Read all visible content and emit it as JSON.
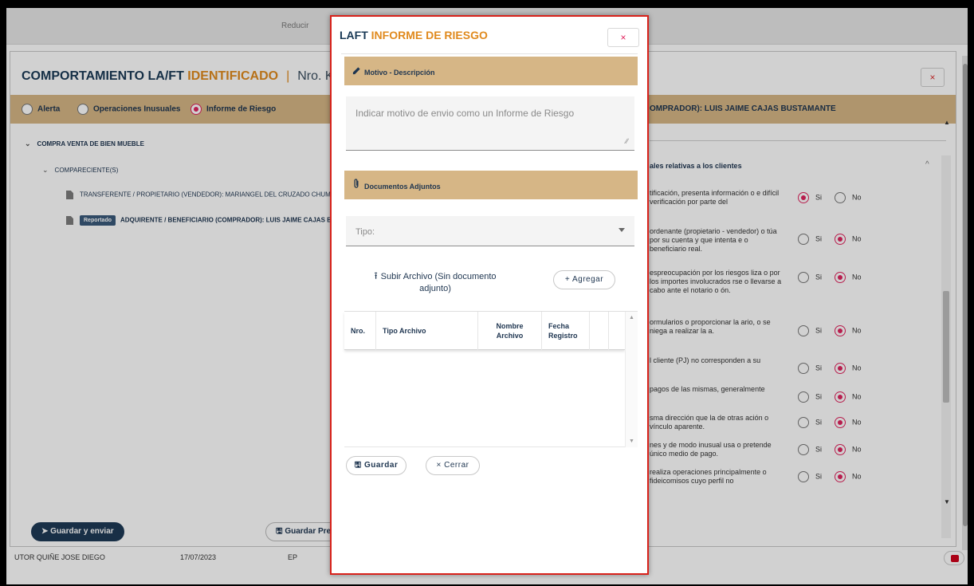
{
  "background": {
    "topbar_label": "Reducir",
    "title_part1": "COMPORTAMIENTO LA/FT",
    "title_part2": "IDENTIFICADO",
    "title_sep": "|",
    "kardex": "Nro. Kardex : AC",
    "close_label": "×",
    "report_types": [
      {
        "label": "Alerta",
        "selected": false
      },
      {
        "label": "Operaciones Inusuales",
        "selected": false
      },
      {
        "label": "Informe de Riesgo",
        "selected": true
      }
    ],
    "right_header": "OMPRADOR): LUIS JAIME CAJAS BUSTAMANTE",
    "tree": {
      "root": "COMPRA VENTA DE BIEN MUEBLE",
      "group": "COMPARECIENTE(S)",
      "item1": "TRANSFERENTE / PROPIETARIO (VENDEDOR): MARIANGEL DEL CRUZADO CHUM",
      "item2_badge": "Reportado",
      "item2": "ADQUIRENTE / BENEFICIARIO (COMPRADOR): LUIS JAIME CAJAS B"
    },
    "right_subheader": "ales relativas a los clientes",
    "questions": [
      {
        "text": "tificación, presenta información o e difícil verificación por parte del",
        "answer": "Si"
      },
      {
        "text": "ordenante (propietario - vendedor) o túa por su cuenta y que intenta e o beneficiario real.",
        "answer": "No"
      },
      {
        "text": "espreocupación por los riesgos liza o por los importes involucrados rse o llevarse a cabo ante el notario o ón.",
        "answer": "No"
      },
      {
        "text": "ormularios o proporcionar la ario, o se niega a realizar la a.",
        "answer": "No"
      },
      {
        "text": "l cliente (PJ) no corresponden a su",
        "answer": "No"
      },
      {
        "text": "pagos de las mismas, generalmente",
        "answer": "No"
      },
      {
        "text": "sma dirección que la de otras ación o vínculo aparente.",
        "answer": "No"
      },
      {
        "text": "nes y de modo inusual usa o pretende único medio de pago.",
        "answer": "No"
      },
      {
        "text": "realiza operaciones principalmente o fideicomisos cuyo perfil no",
        "answer": "No"
      }
    ],
    "si_label": "Si",
    "no_label": "No",
    "btn_save_send": "Guardar y enviar",
    "btn_save_pre": "Guardar Pre",
    "list_row": {
      "name": "UTOR QUIÑE JOSE DIEGO",
      "date": "17/07/2023",
      "type": "EP"
    }
  },
  "modal": {
    "title_part1": "LAFT",
    "title_part2": "INFORME DE RIESGO",
    "close_label": "×",
    "section1": "Motivo - Descripción",
    "textarea_placeholder": "Indicar motivo de envio como un Informe de Riesgo",
    "section2": "Documentos Adjuntos",
    "select_placeholder": "Tipo:",
    "upload_label": "Subir Archivo (Sin documento adjunto)",
    "add_button": "+ Agregar",
    "table_headers": [
      "Nro.",
      "Tipo Archivo",
      "Nombre Archivo",
      "Fecha Registro"
    ],
    "btn_save": "Guardar",
    "btn_close": "× Cerrar"
  },
  "colors": {
    "accent": "#e08a1e",
    "primary": "#1a3a56",
    "section_bg": "#d6b686",
    "radio_selected": "#e0245e",
    "highlight_border": "#d8211a"
  }
}
